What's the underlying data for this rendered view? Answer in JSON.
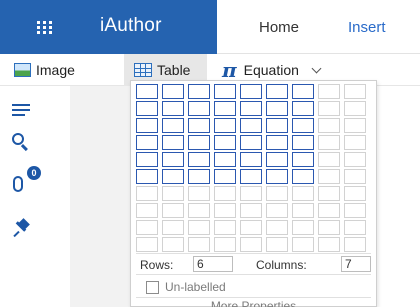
{
  "app": {
    "title": "iAuthor"
  },
  "nav": {
    "tabs": [
      {
        "label": "Home"
      },
      {
        "label": "Insert",
        "active": true
      }
    ]
  },
  "toolbar": {
    "image_label": "Image",
    "table_label": "Table",
    "equation_label": "Equation",
    "equation_symbol": "π"
  },
  "sidebar": {
    "attachments_badge": "0"
  },
  "table_picker": {
    "grid_rows": 10,
    "grid_columns": 9,
    "selected_rows": 6,
    "selected_columns": 7,
    "rows_label": "Rows:",
    "rows_value": "6",
    "columns_label": "Columns:",
    "columns_value": "7",
    "unlabelled_label": "Un-labelled",
    "unlabelled_checked": false,
    "more_properties_label": "More Properties"
  },
  "colors": {
    "brand": "#2563b0",
    "accent": "#2a6bc9",
    "selected_cell_border": "#2b58b0",
    "icon": "#1d57a6"
  }
}
